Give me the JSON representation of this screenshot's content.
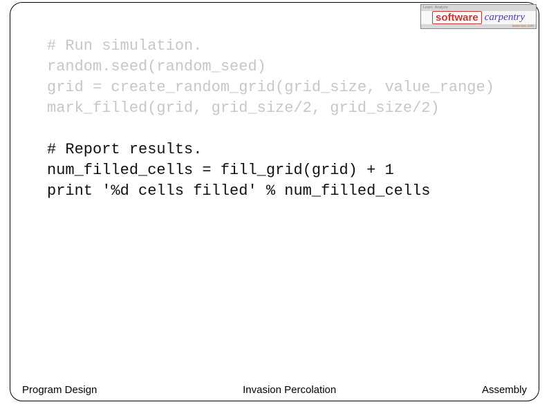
{
  "logo": {
    "top_text": "Learn. Analyze.",
    "software": "software",
    "carpentry": "carpentry",
    "bottom_text": "www.swc.com"
  },
  "code": {
    "line1": "# Run simulation.",
    "line2": "random.seed(random_seed)",
    "line3": "grid = create_random_grid(grid_size, value_range)",
    "line4": "mark_filled(grid, grid_size/2, grid_size/2)",
    "blank1": "",
    "line5": "# Report results.",
    "line6": "num_filled_cells = fill_grid(grid) + 1",
    "line7": "print '%d cells filled' % num_filled_cells"
  },
  "footer": {
    "left": "Program Design",
    "center": "Invasion Percolation",
    "right": "Assembly"
  }
}
